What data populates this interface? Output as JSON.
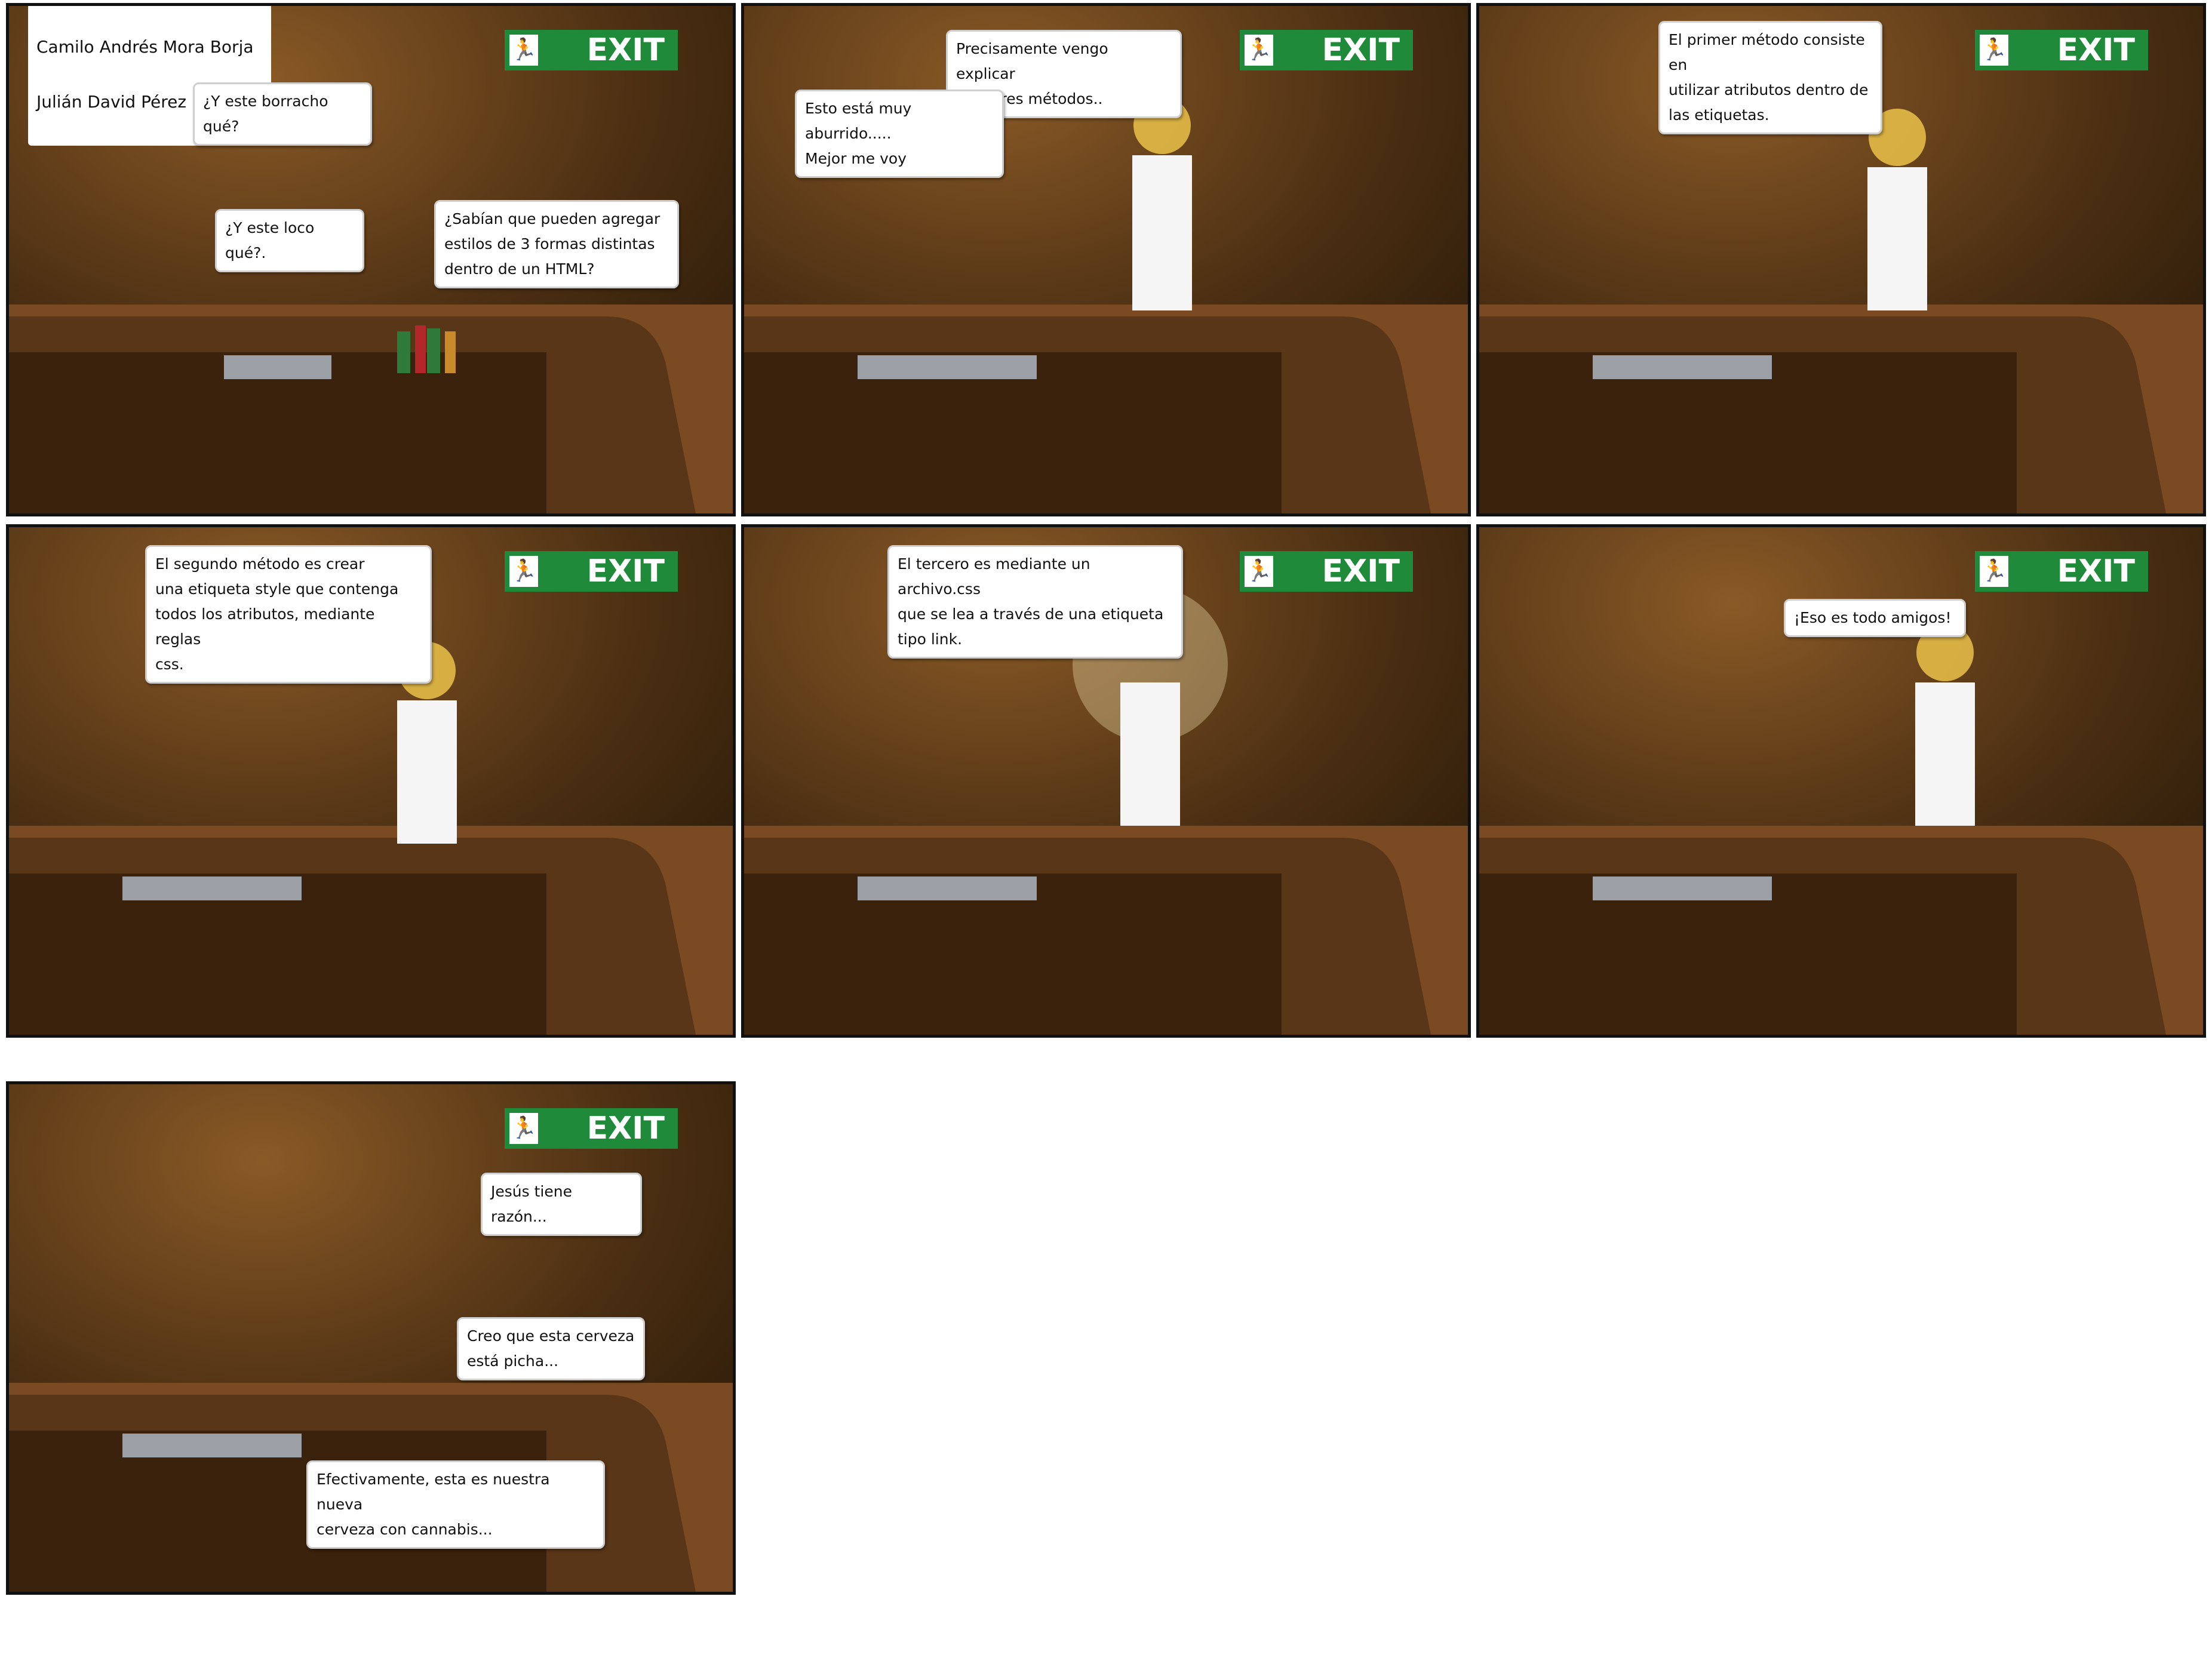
{
  "credits": {
    "line1": "Camilo Andrés Mora Borja",
    "line2": "Julián David Pérez Buitrago"
  },
  "exit_sign": "EXIT",
  "panels": [
    {
      "bubbles": [
        "¿Y este borracho qué?",
        "¿Y este loco qué?.",
        "¿Sabían que pueden agregar\nestilos de 3 formas distintas\ndentro de un HTML?"
      ]
    },
    {
      "bubbles": [
        "Precisamente vengo explicar\nesos tres métodos..",
        "Esto está muy aburrido.....\nMejor me voy"
      ]
    },
    {
      "bubbles": [
        "El primer método consiste en\nutilizar atributos dentro de\nlas etiquetas."
      ]
    },
    {
      "bubbles": [
        "El segundo método es crear\nuna etiqueta style que contenga\ntodos los atributos, mediante reglas\ncss."
      ]
    },
    {
      "bubbles": [
        "El tercero es mediante un archivo.css\nque se lea a través de una etiqueta\ntipo link."
      ]
    },
    {
      "bubbles": [
        "¡Eso es todo amigos!"
      ]
    },
    {
      "bubbles": [
        "Jesús tiene razón...",
        "Creo que esta cerveza\nestá picha...",
        "Efectivamente, esta es nuestra nueva\ncerveza con cannabis..."
      ]
    }
  ],
  "colors": {
    "wall": "#4a2e12",
    "bar_top": "#7a4a22",
    "exit_green": "#1f8a3a"
  }
}
